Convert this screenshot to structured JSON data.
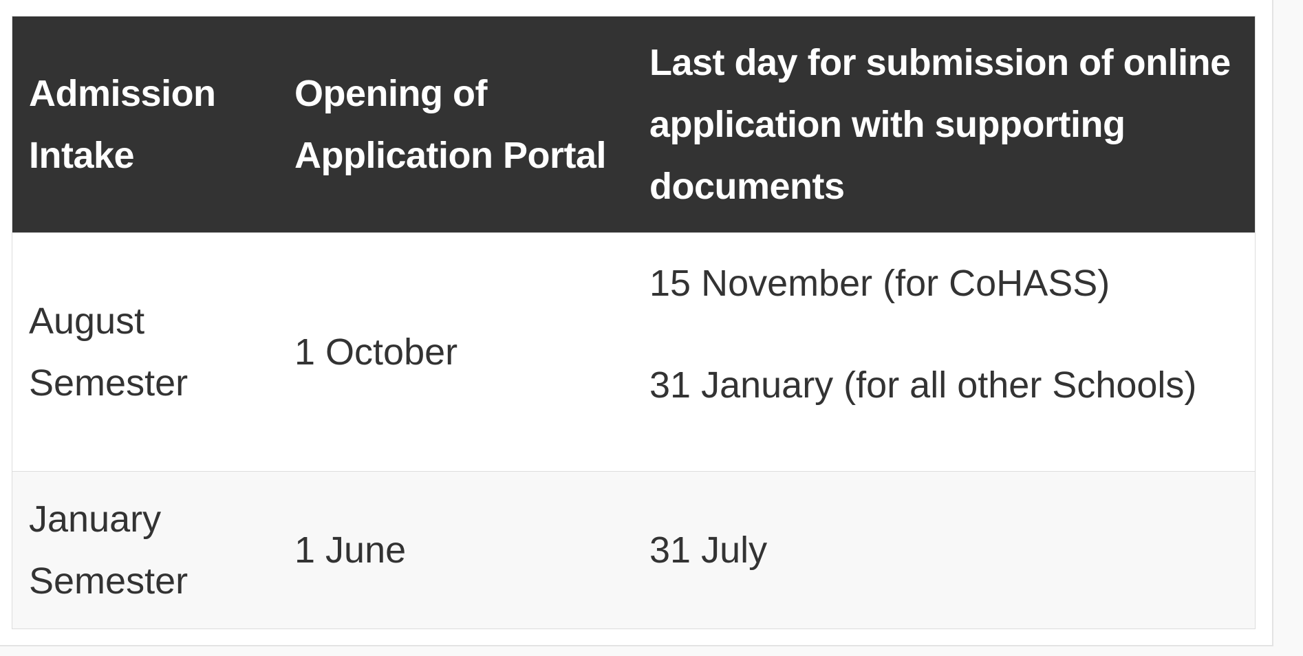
{
  "table": {
    "headers": [
      "Admission Intake",
      "Opening of Application Portal",
      "Last day for submission of online application with supporting documents"
    ],
    "rows": [
      {
        "intake": "August Semester",
        "opening": "1 October",
        "deadlines": [
          "15 November (for CoHASS)",
          "31 January (for all other Schools)"
        ]
      },
      {
        "intake": "January Semester",
        "opening": "1 June",
        "deadlines": [
          "31 July"
        ]
      }
    ]
  },
  "colors": {
    "header_background": "#333333",
    "header_text": "#ffffff",
    "body_text": "#333333",
    "alt_row_background": "#f8f8f8"
  }
}
